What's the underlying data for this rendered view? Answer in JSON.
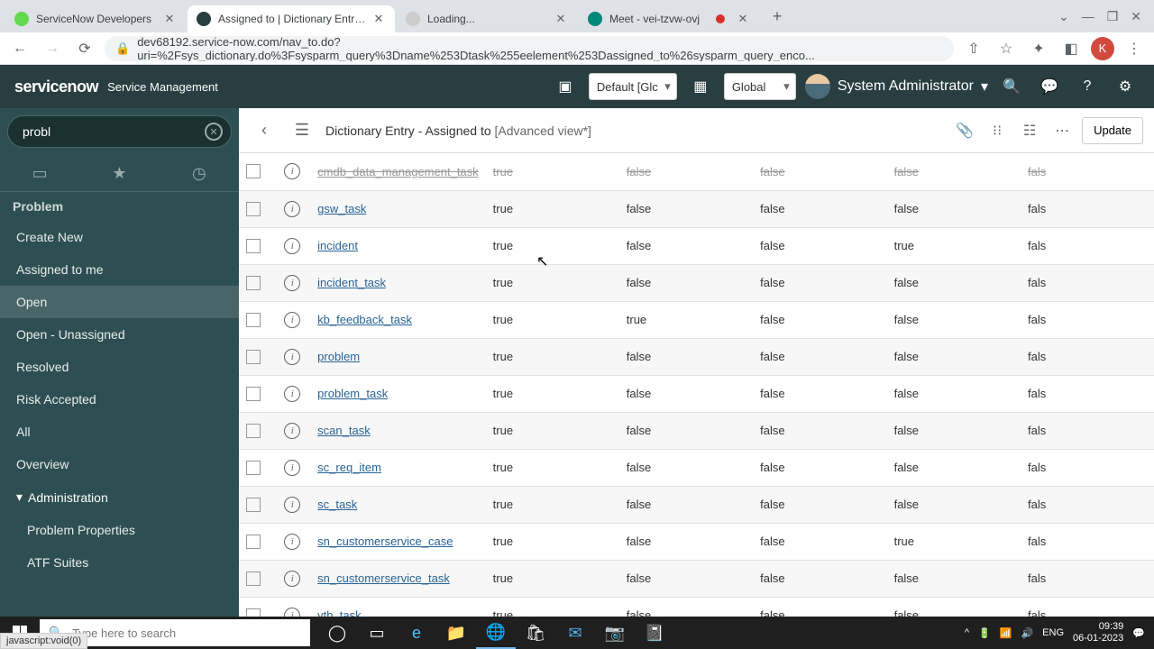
{
  "browser": {
    "tabs": [
      {
        "title": "ServiceNow Developers",
        "icon": "#62d84e"
      },
      {
        "title": "Assigned to | Dictionary Entry | S",
        "icon": "#293e40",
        "active": true
      },
      {
        "title": "Loading...",
        "icon": "#ccc"
      },
      {
        "title": "Meet - vei-tzvw-ovj",
        "icon": "#00897b",
        "recording": true
      }
    ],
    "url": "dev68192.service-now.com/nav_to.do?uri=%2Fsys_dictionary.do%3Fsysparm_query%3Dname%253Dtask%255eelement%253Dassigned_to%26sysparm_query_enco...",
    "avatar": "K"
  },
  "header": {
    "logo": "servicenow",
    "subtitle": "Service Management",
    "picker1": "Default [Glc",
    "picker2": "Global",
    "user": "System Administrator"
  },
  "nav": {
    "filter": "probl",
    "module_header": "Problem",
    "items": [
      {
        "label": "Create New"
      },
      {
        "label": "Assigned to me"
      },
      {
        "label": "Open",
        "active": true
      },
      {
        "label": "Open - Unassigned"
      },
      {
        "label": "Resolved"
      },
      {
        "label": "Risk Accepted"
      },
      {
        "label": "All"
      },
      {
        "label": "Overview"
      }
    ],
    "group": "Administration",
    "sub_items": [
      {
        "label": "Problem Properties"
      },
      {
        "label": "ATF Suites"
      }
    ]
  },
  "form": {
    "back": "‹",
    "title": "Dictionary Entry - Assigned to",
    "view": "[Advanced view*]",
    "update": "Update"
  },
  "table": {
    "rows": [
      {
        "name": "cmdb_data_management_task",
        "c1": "true",
        "c2": "false",
        "c3": "false",
        "c4": "false",
        "c5": "fals",
        "top": true
      },
      {
        "name": "gsw_task",
        "c1": "true",
        "c2": "false",
        "c3": "false",
        "c4": "false",
        "c5": "fals"
      },
      {
        "name": "incident",
        "c1": "true",
        "c2": "false",
        "c3": "false",
        "c4": "true",
        "c5": "fals"
      },
      {
        "name": "incident_task",
        "c1": "true",
        "c2": "false",
        "c3": "false",
        "c4": "false",
        "c5": "fals"
      },
      {
        "name": "kb_feedback_task",
        "c1": "true",
        "c2": "true",
        "c3": "false",
        "c4": "false",
        "c5": "fals"
      },
      {
        "name": "problem",
        "c1": "true",
        "c2": "false",
        "c3": "false",
        "c4": "false",
        "c5": "fals"
      },
      {
        "name": "problem_task",
        "c1": "true",
        "c2": "false",
        "c3": "false",
        "c4": "false",
        "c5": "fals"
      },
      {
        "name": "scan_task",
        "c1": "true",
        "c2": "false",
        "c3": "false",
        "c4": "false",
        "c5": "fals"
      },
      {
        "name": "sc_req_item",
        "c1": "true",
        "c2": "false",
        "c3": "false",
        "c4": "false",
        "c5": "fals"
      },
      {
        "name": "sc_task",
        "c1": "true",
        "c2": "false",
        "c3": "false",
        "c4": "false",
        "c5": "fals"
      },
      {
        "name": "sn_customerservice_case",
        "c1": "true",
        "c2": "false",
        "c3": "false",
        "c4": "true",
        "c5": "fals"
      },
      {
        "name": "sn_customerservice_task",
        "c1": "true",
        "c2": "false",
        "c3": "false",
        "c4": "false",
        "c5": "fals"
      },
      {
        "name": "vtb_task",
        "c1": "true",
        "c2": "false",
        "c3": "false",
        "c4": "false",
        "c5": "fals"
      }
    ]
  },
  "status_tip": "javascript:void(0)",
  "taskbar": {
    "search": "Type here to search",
    "lang": "ENG",
    "time": "09:39",
    "date": "06-01-2023"
  }
}
